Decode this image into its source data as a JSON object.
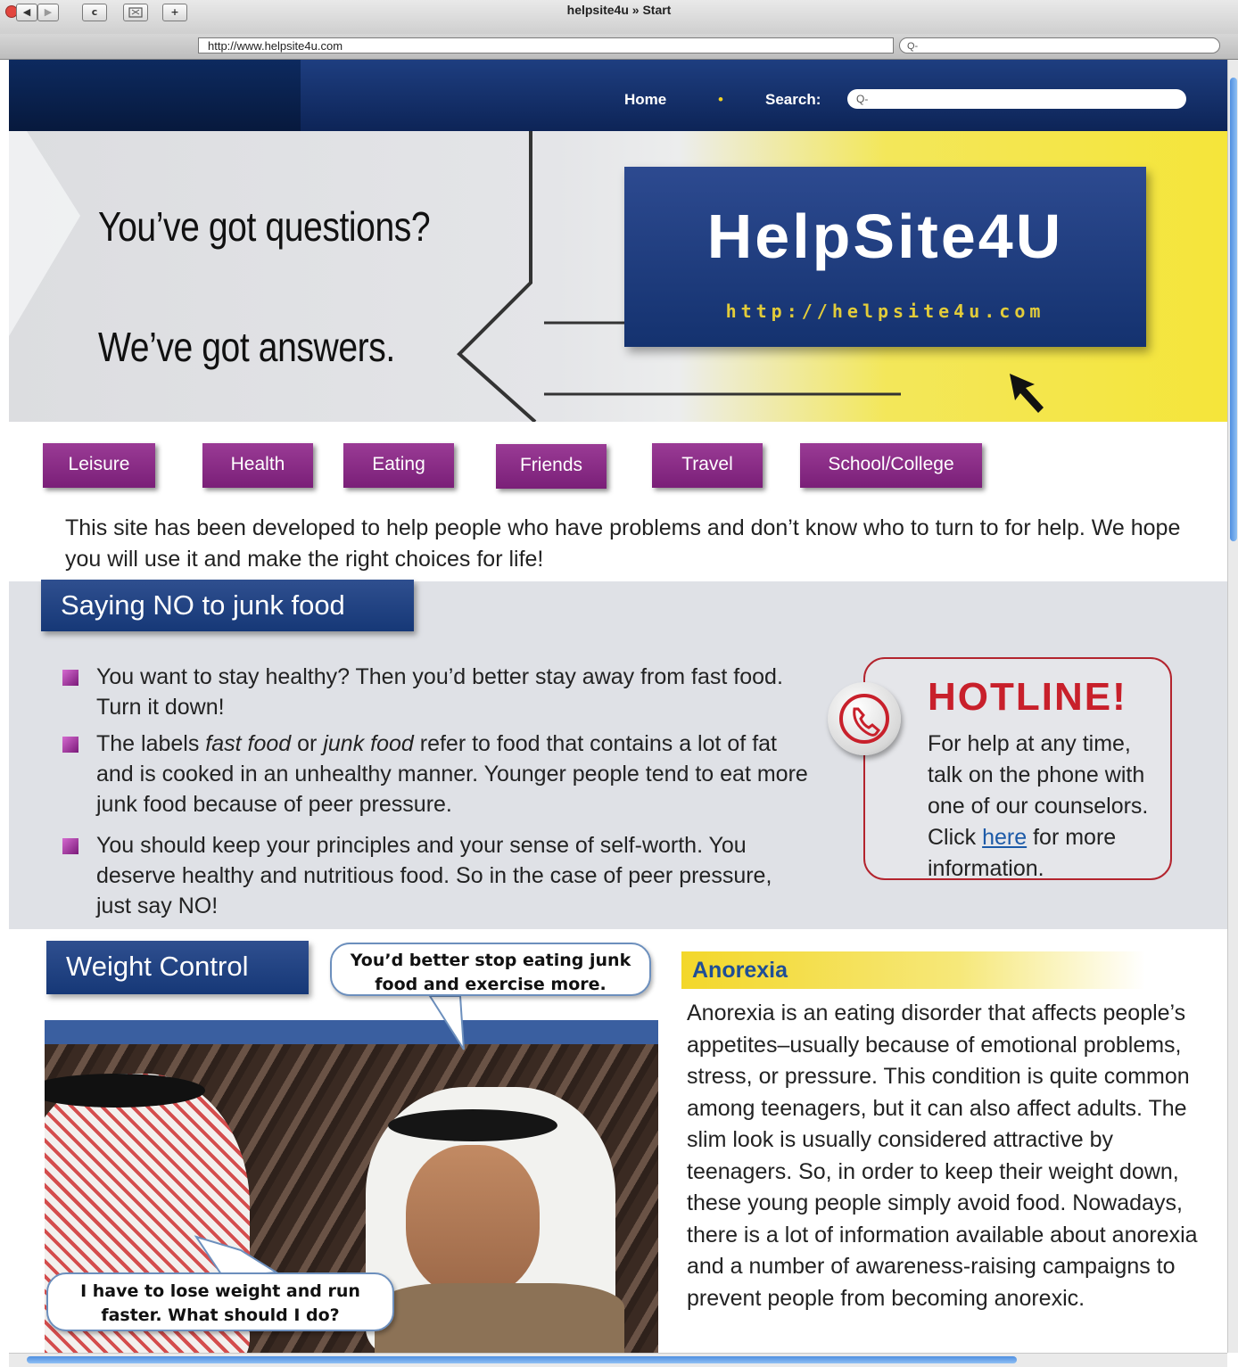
{
  "browser": {
    "window_title": "helpsite4u » Start",
    "url": "http://www.helpsite4u.com",
    "search_placeholder": "Q-",
    "buttons": {
      "back": "◀",
      "forward": "▶",
      "reload": "c",
      "add": "+"
    }
  },
  "nav": {
    "home": "Home",
    "separator": "•",
    "search_label": "Search:",
    "search_placeholder": "Q-"
  },
  "banner": {
    "line1": "You’ve got questions?",
    "line2": "We’ve got answers.",
    "logo_name": "HelpSite4U",
    "logo_url": "http://helpsite4u.com"
  },
  "categories": [
    "Leisure",
    "Health",
    "Eating",
    "Friends",
    "Travel",
    "School/College"
  ],
  "intro": "This site has been developed to help people who have problems and don’t know who to turn to for help. We hope you will use it and make the right choices for life!",
  "junk_food": {
    "heading": "Saying NO to junk food",
    "bullet1": "You want to stay healthy? Then you’d better stay away from fast food. Turn it down!",
    "bullet2_a": "The labels ",
    "bullet2_i1": "fast food",
    "bullet2_b": " or ",
    "bullet2_i2": "junk food",
    "bullet2_c": " refer to food that contains a lot of fat and is cooked in an unhealthy manner. Younger people tend to eat more junk food because of peer pressure.",
    "bullet3": "You should keep your principles and your sense of self-worth. You deserve healthy and nutritious food. So in the case of peer pressure, just say NO!"
  },
  "hotline": {
    "title": "HOTLINE!",
    "text_a": "For help at any time, talk on the phone with one of our counselors. Click ",
    "link": "here",
    "text_b": " for more information."
  },
  "weight": {
    "heading": "Weight Control",
    "bubble_top": "You’d better stop eating junk food and exercise more.",
    "bubble_bottom": "I have to lose weight and run faster. What should I do?"
  },
  "anorexia": {
    "heading": "Anorexia",
    "text": "Anorexia is an eating disorder that affects people’s appetites–usually because of emotional problems, stress, or pressure. This condition is quite common among teenagers, but it can also affect adults.  The slim look is usually considered attractive by teenagers. So, in order to keep their weight down, these young people simply avoid food. Nowadays, there is a lot of information available about anorexia and a number of awareness-raising campaigns to prevent people from becoming anorexic."
  },
  "colors": {
    "nav_blue": "#163877",
    "category_purple": "#8a2b87",
    "hotline_red": "#c8202b",
    "banner_yellow": "#f5e53a",
    "anorexia_heading": "#1f4e96"
  }
}
